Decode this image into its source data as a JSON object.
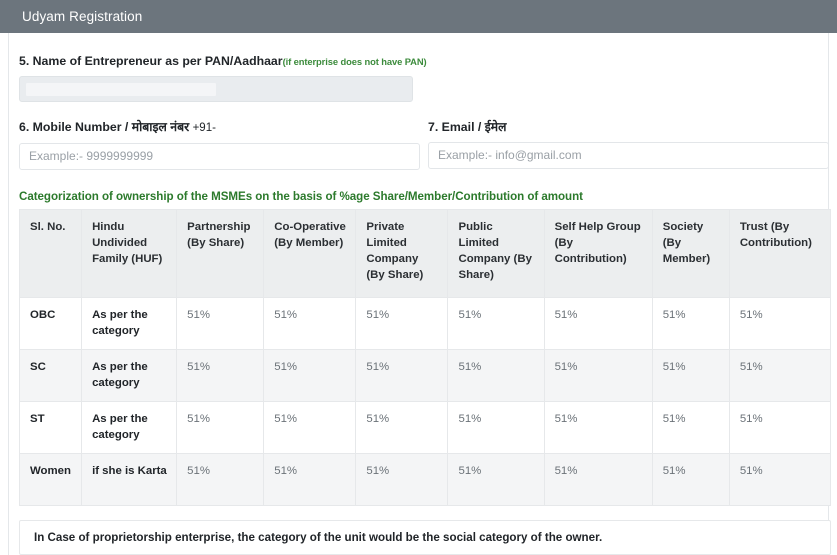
{
  "header": {
    "title": "Udyam Registration"
  },
  "fields": {
    "name": {
      "label": "5. Name of Entrepreneur as per PAN/Aadhaar",
      "sub": "(if enterprise does not have PAN)",
      "value": "",
      "disabled": true
    },
    "mobile": {
      "label": "6. Mobile Number / मोबाइल नंबर ",
      "suffix": "+91-",
      "placeholder": "Example:- 9999999999",
      "value": ""
    },
    "email": {
      "label": "7. Email / ईमेल",
      "placeholder": "Example:- info@gmail.com",
      "value": ""
    }
  },
  "section": {
    "heading": "Categorization of ownership of the MSMEs on the basis of %age Share/Member/Contribution of amount"
  },
  "table": {
    "columns": [
      "Sl. No.",
      "Hindu Undivided Family (HUF)",
      "Partnership (By Share)",
      "Co-Operative (By Member)",
      "Private Limited Company (By Share)",
      "Public Limited Company (By Share)",
      "Self Help Group (By Contribution)",
      "Society (By Member)",
      "Trust (By Contribution)"
    ],
    "rows": [
      [
        "OBC",
        "As per the category",
        "51%",
        "51%",
        "51%",
        "51%",
        "51%",
        "51%",
        "51%"
      ],
      [
        "SC",
        "As per the category",
        "51%",
        "51%",
        "51%",
        "51%",
        "51%",
        "51%",
        "51%"
      ],
      [
        "ST",
        "As per the category",
        "51%",
        "51%",
        "51%",
        "51%",
        "51%",
        "51%",
        "51%"
      ],
      [
        "Women",
        "if she is Karta",
        "51%",
        "51%",
        "51%",
        "51%",
        "51%",
        "51%",
        "51%"
      ]
    ]
  },
  "note": {
    "text": "In Case of proprietorship enterprise, the category of the unit would be the social category of the owner."
  },
  "colors": {
    "header_bar": "#6c757d",
    "accent_green": "#2c7a2c",
    "table_head_bg": "#eceeef",
    "row_alt_bg": "#f4f5f6"
  }
}
